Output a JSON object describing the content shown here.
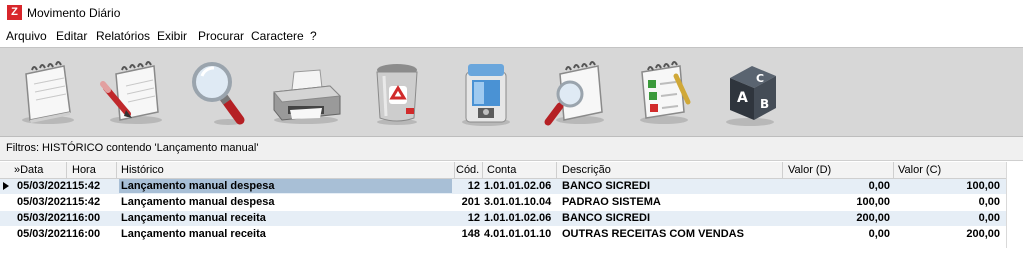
{
  "window": {
    "title": "Movimento Diário",
    "icon": "app-logo-icon"
  },
  "menu": [
    "Arquivo",
    "Editar",
    "Relatórios",
    "Exibir",
    "Procurar",
    "Caractere",
    "?"
  ],
  "toolbar": {
    "buttons": [
      {
        "name": "notebook-icon"
      },
      {
        "name": "edit-notebook-icon"
      },
      {
        "name": "magnifier-icon"
      },
      {
        "name": "printer-icon"
      },
      {
        "name": "trash-icon"
      },
      {
        "name": "water-cooler-icon"
      },
      {
        "name": "search-notebook-icon"
      },
      {
        "name": "checklist-icon"
      },
      {
        "name": "abc-block-icon"
      }
    ]
  },
  "filter": {
    "text": "Filtros:  HISTÓRICO contendo 'Lançamento manual'"
  },
  "grid": {
    "columns": [
      "»Data",
      "Hora",
      "Histórico",
      "Cód.",
      "Conta",
      "Descrição",
      "Valor (D)",
      "Valor (C)"
    ],
    "rows": [
      {
        "data": "05/03/2021",
        "hora": "15:42",
        "historico": "Lançamento manual despesa",
        "cod": "12",
        "conta": "1.01.01.02.06",
        "descricao": "BANCO SICREDI",
        "valor_d": "0,00",
        "valor_c": "100,00"
      },
      {
        "data": "05/03/2021",
        "hora": "15:42",
        "historico": "Lançamento manual despesa",
        "cod": "201",
        "conta": "3.01.01.10.04",
        "descricao": "PADRAO SISTEMA",
        "valor_d": "100,00",
        "valor_c": "0,00"
      },
      {
        "data": "05/03/2021",
        "hora": "16:00",
        "historico": "Lançamento manual receita",
        "cod": "12",
        "conta": "1.01.01.02.06",
        "descricao": "BANCO SICREDI",
        "valor_d": "200,00",
        "valor_c": "0,00"
      },
      {
        "data": "05/03/2021",
        "hora": "16:00",
        "historico": "Lançamento manual receita",
        "cod": "148",
        "conta": "4.01.01.01.10",
        "descricao": "OUTRAS RECEITAS COM VENDAS",
        "valor_d": "0,00",
        "valor_c": "200,00"
      }
    ]
  },
  "colors": {
    "selection": "#a8bfd6",
    "toolbar_bg": "#d7d7d7",
    "row_alt": "#e6eef6",
    "icon_red": "#d8262b"
  }
}
